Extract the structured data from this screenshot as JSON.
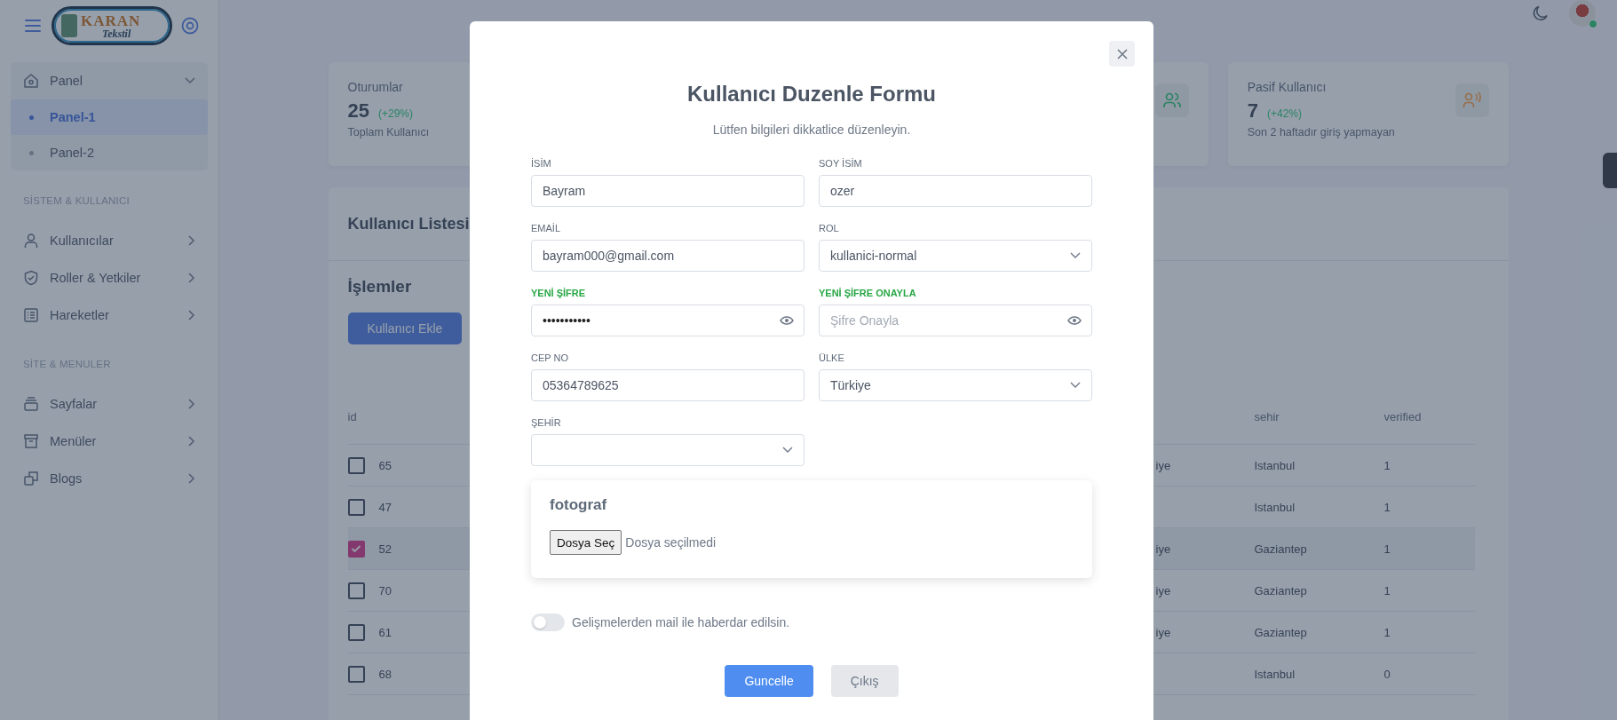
{
  "logo": {
    "name": "KARAN",
    "tagline": "Tekstil"
  },
  "sidebar": {
    "groups": [
      {
        "items": [
          {
            "label": "Panel",
            "expanded": true,
            "children": [
              {
                "label": "Panel-1",
                "selected": true
              },
              {
                "label": "Panel-2",
                "selected": false
              }
            ]
          }
        ]
      },
      {
        "heading": "SİSTEM & KULLANICI",
        "items": [
          {
            "label": "Kullanıcılar",
            "expanded": false
          },
          {
            "label": "Roller & Yetkiler",
            "expanded": false
          },
          {
            "label": "Hareketler",
            "expanded": false
          }
        ]
      },
      {
        "heading": "SİTE & MENULER",
        "items": [
          {
            "label": "Sayfalar",
            "expanded": false
          },
          {
            "label": "Menüler",
            "expanded": false
          },
          {
            "label": "Blogs",
            "expanded": false
          }
        ]
      }
    ]
  },
  "header": {
    "user_online": true
  },
  "stat_cards": [
    {
      "title": "Oturumlar",
      "value": "25",
      "change": "(+29%)",
      "note": "Toplam Kullanıcı"
    },
    {
      "color": "#2c8363"
    },
    {
      "title": "Pasif Kullanıcı",
      "value": "7",
      "change": "(+42%)",
      "note": "Son 2 haftadır giriş yapmayan",
      "color": "#976f4d"
    }
  ],
  "user_list": {
    "title": "Kullanıcı Listesi",
    "actions_title": "İşlemler",
    "add_button": "Kullanıcı Ekle",
    "columns": [
      "id",
      "sehir",
      "verified"
    ],
    "rows": [
      {
        "selected": false,
        "id": "65",
        "column_2": "iye",
        "sehir": "Istanbul",
        "verified": "1"
      },
      {
        "selected": false,
        "id": "47",
        "sehir": "Istanbul",
        "verified": "1"
      },
      {
        "selected": true,
        "id": "52",
        "column_2": "iye",
        "sehir": "Gaziantep",
        "verified": "1"
      },
      {
        "selected": false,
        "id": "70",
        "column_2": "iye",
        "sehir": "Gaziantep",
        "verified": "1"
      },
      {
        "selected": false,
        "id": "61",
        "column_2": "iye",
        "sehir": "Gaziantep",
        "verified": "1"
      },
      {
        "selected": false,
        "id": "68",
        "sehir": "Istanbul",
        "verified": "0"
      }
    ]
  },
  "modal": {
    "title": "Kullanıcı Duzenle Formu",
    "subtitle": "Lütfen bilgileri dikkatlice düzenleyin.",
    "fields": [
      {
        "kind": "text",
        "label": "İSİM",
        "value": "Bayram",
        "valid": false
      },
      {
        "kind": "text",
        "label": "SOY İSİM",
        "value": "ozer",
        "valid": false
      },
      {
        "kind": "text",
        "label": "EMAİL",
        "value": "bayram000@gmail.com",
        "valid": false
      },
      {
        "kind": "select",
        "label": "ROL",
        "value": "kullanici-normal",
        "valid": false
      },
      {
        "kind": "password",
        "label": "YENİ ŞİFRE",
        "value": "•••••••••••",
        "valid": true
      },
      {
        "kind": "password",
        "label": "YENİ ŞİFRE ONAYLA",
        "placeholder": "Şifre Onayla",
        "valid": true
      },
      {
        "kind": "text",
        "label": "CEP NO",
        "value": "05364789625",
        "valid": false
      },
      {
        "kind": "select",
        "label": "ÜLKE",
        "value": "Türkiye",
        "valid": false
      },
      {
        "kind": "select",
        "label": "ŞEHİR",
        "valid": false
      }
    ],
    "photo": {
      "title": "fotograf",
      "button": "Dosya Seç",
      "status": "Dosya seçilmedi"
    },
    "toggle": {
      "label": "Gelişmelerden mail ile haberdar edilsin.",
      "on": false
    },
    "buttons": [
      {
        "label": "Guncelle",
        "kind": "primary"
      },
      {
        "label": "Çıkış",
        "kind": "secondary"
      }
    ]
  }
}
